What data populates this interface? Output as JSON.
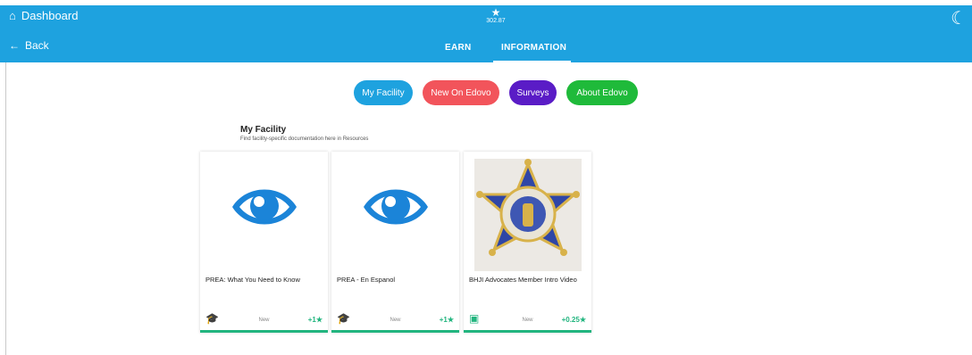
{
  "header": {
    "dashboard_label": "Dashboard",
    "back_label": "Back",
    "points_value": "302.87",
    "background_color": "#1ea2df",
    "tabs": [
      {
        "label": "EARN",
        "active": false
      },
      {
        "label": "INFORMATION",
        "active": true
      }
    ]
  },
  "filters": [
    {
      "label": "My Facility",
      "color": "#1ea2df"
    },
    {
      "label": "New On Edovo",
      "color": "#f2545b"
    },
    {
      "label": "Surveys",
      "color": "#5a1cc6"
    },
    {
      "label": "About Edovo",
      "color": "#1fba3a"
    }
  ],
  "section": {
    "title": "My Facility",
    "subtitle": "Find facility-specific documentation here in Resources"
  },
  "cards": [
    {
      "title": "PREA: What You Need to Know",
      "icon": "eye-icon",
      "type_icon": "graduation-cap-icon",
      "status": "New",
      "reward": "+1"
    },
    {
      "title": "PREA - En Espanol",
      "icon": "eye-icon",
      "type_icon": "graduation-cap-icon",
      "status": "New",
      "reward": "+1"
    },
    {
      "title": "BHJI Advocates Member Intro Video",
      "icon": "sheriff-badge-image",
      "type_icon": "clapperboard-icon",
      "status": "New",
      "reward": "+0.25"
    }
  ],
  "accent_color": "#22b57f"
}
